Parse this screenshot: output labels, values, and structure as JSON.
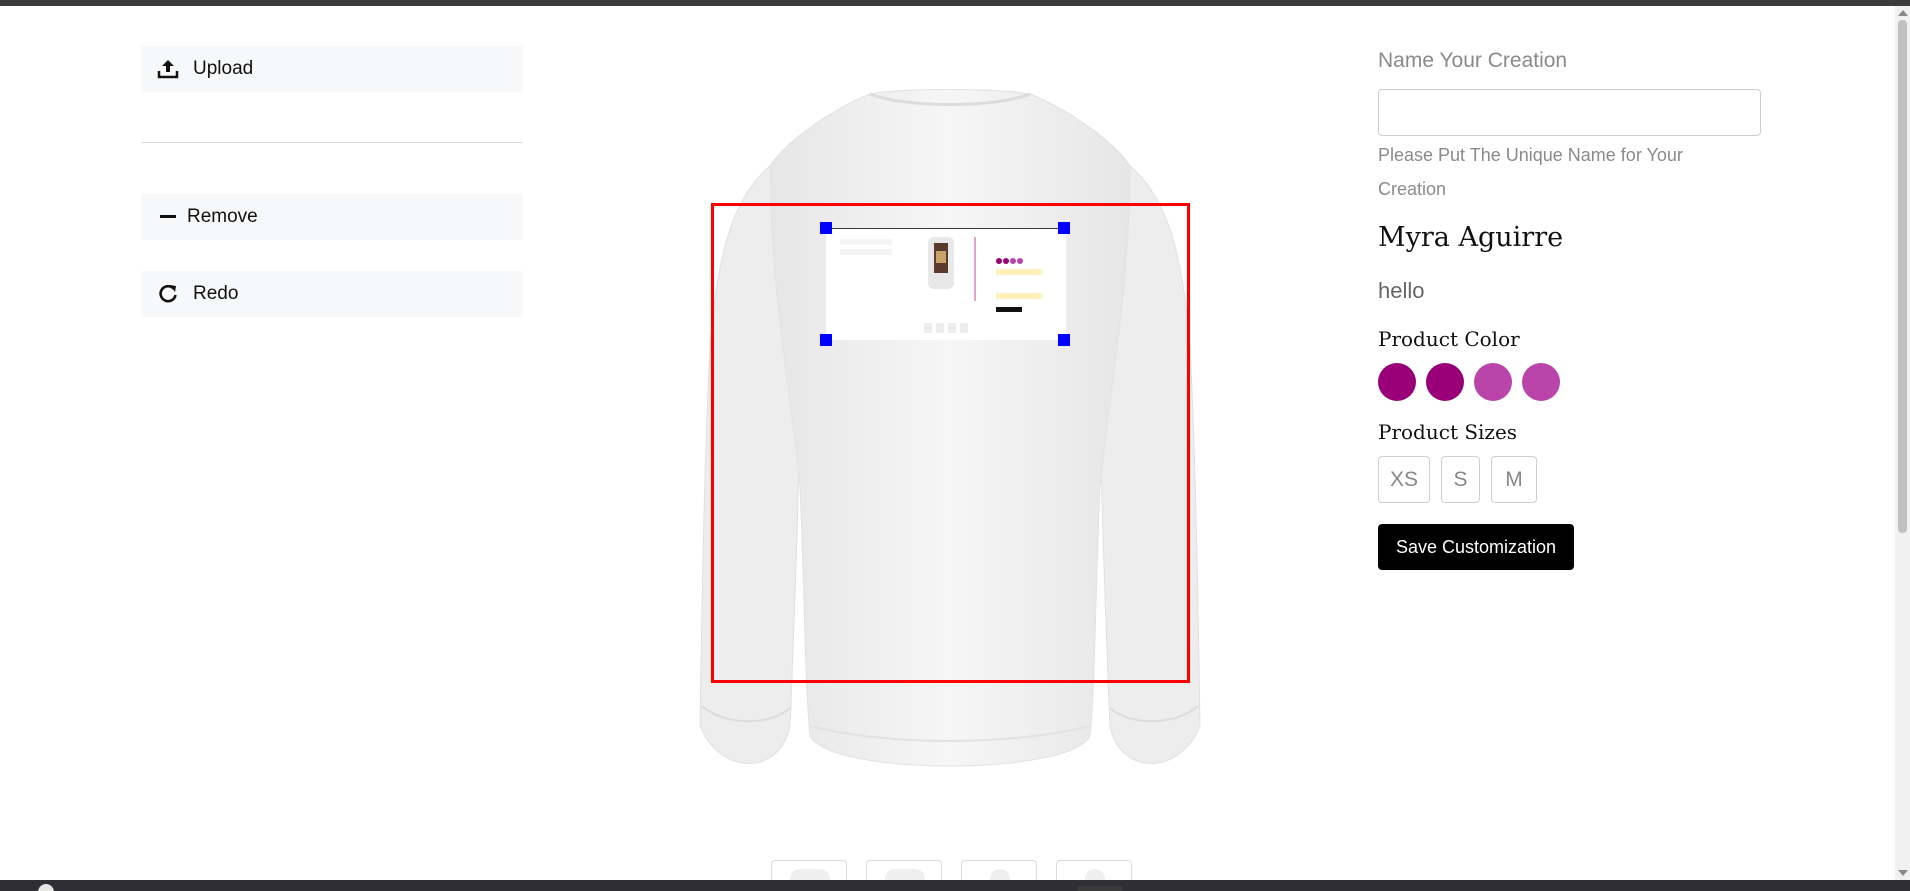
{
  "tools": {
    "upload_label": "Upload",
    "remove_label": "Remove",
    "redo_label": "Redo"
  },
  "form": {
    "name_label": "Name Your Creation",
    "name_value": "",
    "name_help": "Please Put The Unique Name for Your Creation",
    "creator_name": "Myra Aguirre",
    "message": "hello",
    "color_title": "Product Color",
    "colors": [
      "#990077",
      "#990077",
      "#bb44aa",
      "#bb44aa"
    ],
    "size_title": "Product Sizes",
    "sizes": [
      "XS",
      "S",
      "M"
    ],
    "save_label": "Save Customization"
  },
  "canvas": {
    "print_area_color": "#ff0000",
    "handle_color": "#0000ff"
  }
}
